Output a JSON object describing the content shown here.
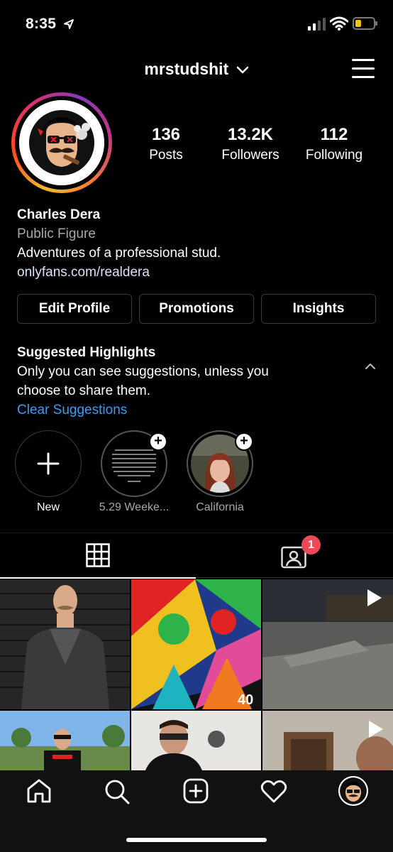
{
  "status_bar": {
    "time": "8:35"
  },
  "profile": {
    "username": "mrstudshit",
    "stats": [
      {
        "value": "136",
        "label": "Posts"
      },
      {
        "value": "13.2K",
        "label": "Followers"
      },
      {
        "value": "112",
        "label": "Following"
      }
    ],
    "name": "Charles Dera",
    "category": "Public Figure",
    "bio": "Adventures of a professional stud.",
    "link": "onlyfans.com/realdera"
  },
  "buttons": {
    "edit": "Edit Profile",
    "promotions": "Promotions",
    "insights": "Insights"
  },
  "suggested": {
    "title": "Suggested Highlights",
    "line1": "Only you can see suggestions, unless you",
    "line2": "choose to share them.",
    "clear": "Clear Suggestions"
  },
  "highlights": [
    {
      "label": "New"
    },
    {
      "label": "5.29 Weeke..."
    },
    {
      "label": "California"
    }
  ],
  "tabs": {
    "tagged_badge": "1"
  },
  "colors": {
    "link_blue": "#3f9af5",
    "badge_red": "#ed4956",
    "background": "#000000"
  }
}
